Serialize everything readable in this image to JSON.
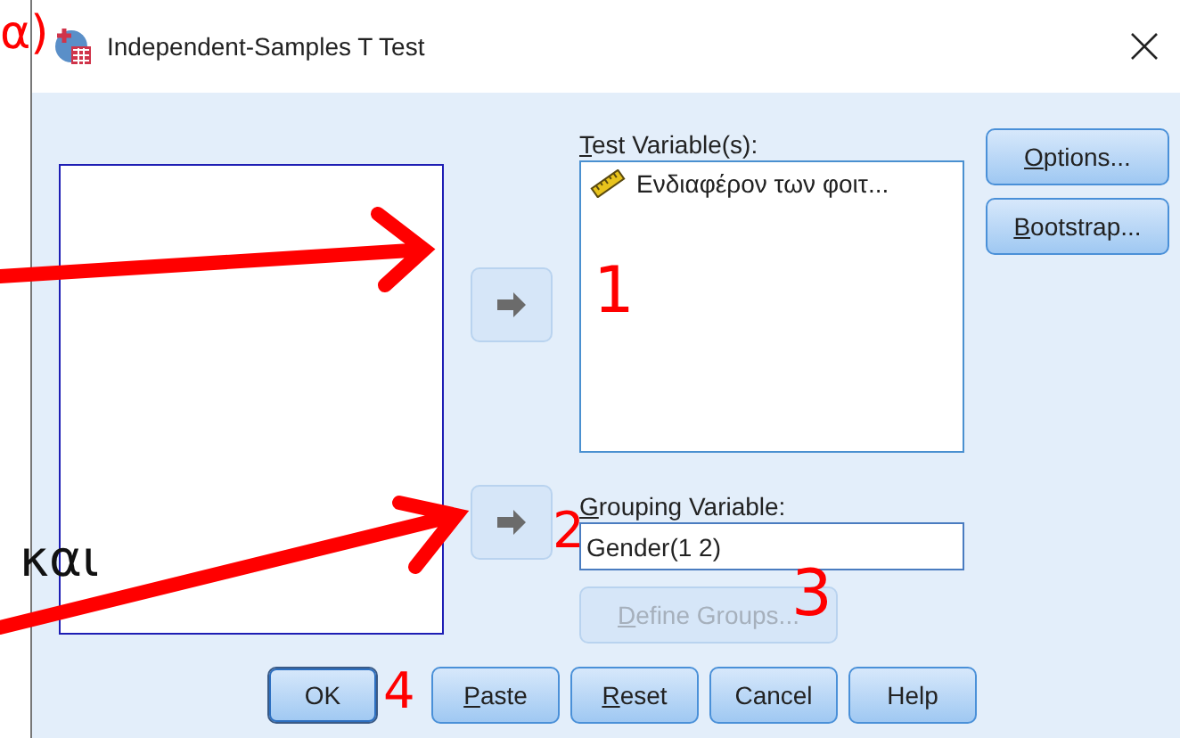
{
  "window": {
    "title": "Independent-Samples T Test"
  },
  "test_variables": {
    "label": "Test Variable(s):",
    "mnemonic": true,
    "items": [
      {
        "name": "Ενδιαφέρον των φοιτ..."
      }
    ]
  },
  "grouping_variable": {
    "label": "Grouping Variable:",
    "mnemonic": true,
    "value": "Gender(1 2)"
  },
  "define_groups": {
    "label": "Define Groups...",
    "mnemonic": true,
    "disabled": true
  },
  "side_buttons": [
    {
      "label": "Options...",
      "mnemonic": true
    },
    {
      "label": "Bootstrap...",
      "mnemonic": true
    }
  ],
  "bottom_buttons": [
    {
      "label": "OK",
      "mnemonic": false,
      "default": true
    },
    {
      "label": "Paste",
      "mnemonic": true,
      "default": false
    },
    {
      "label": "Reset",
      "mnemonic": true,
      "default": false
    },
    {
      "label": "Cancel",
      "mnemonic": false,
      "default": false
    },
    {
      "label": "Help",
      "mnemonic": false,
      "default": false
    }
  ],
  "annotations": {
    "step_label": "α)",
    "conjunction": "και",
    "numbers": [
      "1",
      "2",
      "3",
      "4"
    ]
  }
}
